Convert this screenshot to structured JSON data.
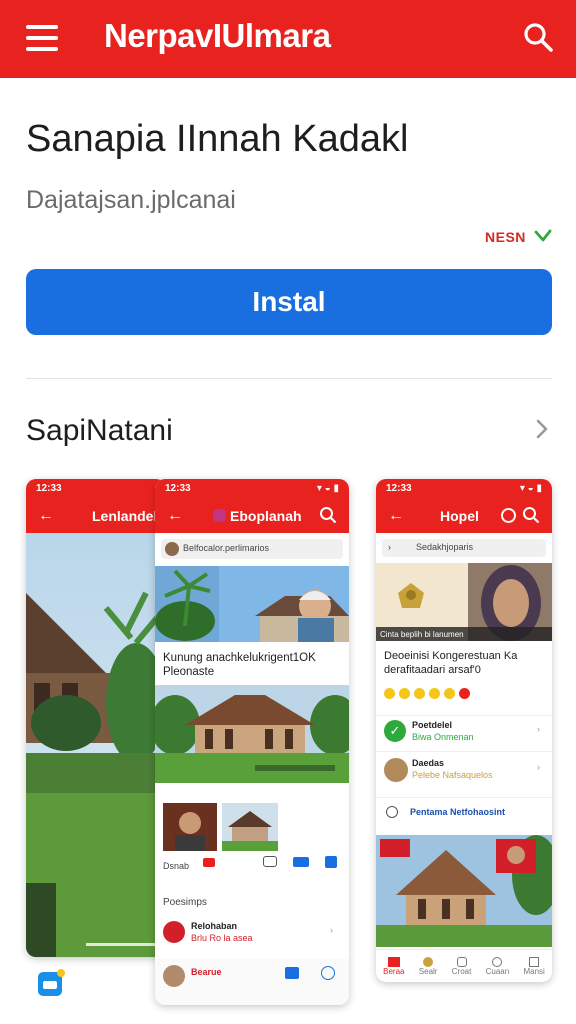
{
  "header": {
    "title": "NerpavIUlmara"
  },
  "app": {
    "name": "Sanapia IInnah Kadakl",
    "developer": "Dajatajsan.jplcanai",
    "badge": "NESN",
    "install_label": "Instal"
  },
  "screenshots_section": {
    "title": "SapiNatani"
  },
  "phone1": {
    "time": "12:33",
    "title": "Lenlandeli"
  },
  "phone2": {
    "time": "12:33",
    "title": "Eboplanah",
    "search_hint": "Belfocalor.perlimarios",
    "article_title": "Kunung anachkelukrigent1OK Pleonaste",
    "section_label": "Poesimps",
    "item1_title": "Relohaban",
    "item1_sub": "Brlu Ro la asea",
    "item2_title": "Bearue"
  },
  "phone3": {
    "time": "12:33",
    "title": "Hopel",
    "search_hint": "Sedakhjoparis",
    "banner_text": "Cinta beplih bi lanumen",
    "article_title": "Deoeinisi Kongerestuan Ka derafitaadari arsaf'0",
    "list1_title": "Poetdelel",
    "list1_sub": "Biwa Onmenan",
    "list2_title": "Daedas",
    "list2_sub": "Pelebe Nafsaquelos",
    "link_text": "Pentama Netfohaosint",
    "tabs": [
      "Beraa",
      "Sealr",
      "Croat",
      "Cuaan",
      "Mansi"
    ]
  },
  "colors": {
    "primary": "#e8231f",
    "install": "#1a6fe0",
    "check": "#2eaa3c"
  }
}
